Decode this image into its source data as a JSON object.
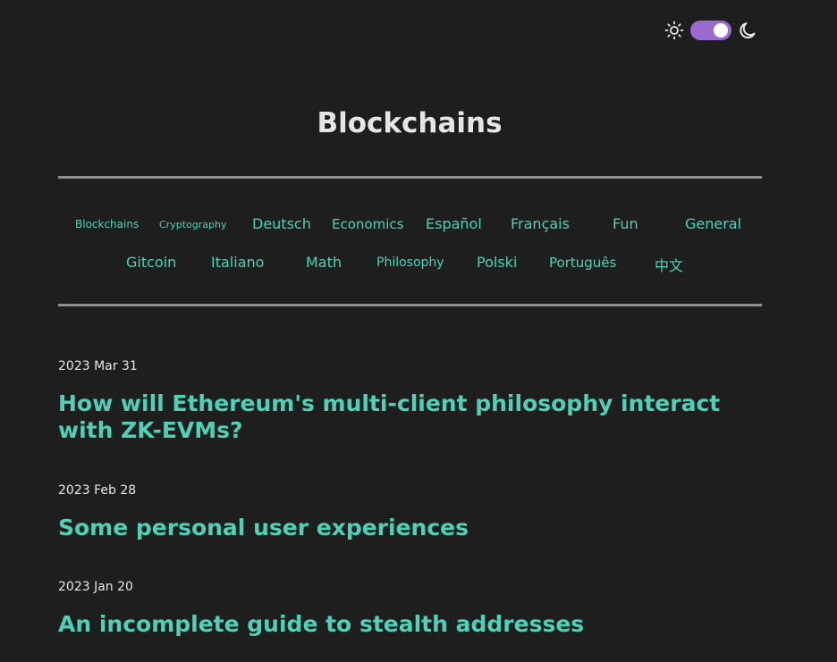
{
  "theme": {
    "switch_color": "#9b6ad1",
    "icons": [
      "sun-icon",
      "moon-icon"
    ],
    "dark_mode_enabled": true
  },
  "page": {
    "title": "Blockchains"
  },
  "categories": [
    "Blockchains",
    "Cryptography",
    "Deutsch",
    "Economics",
    "Español",
    "Français",
    "Fun",
    "General",
    "Gitcoin",
    "Italiano",
    "Math",
    "Philosophy",
    "Polski",
    "Português",
    "中文"
  ],
  "posts": [
    {
      "date": "2023 Mar 31",
      "title": "How will Ethereum's multi-client philosophy interact with ZK-EVMs?"
    },
    {
      "date": "2023 Feb 28",
      "title": "Some personal user experiences"
    },
    {
      "date": "2023 Jan 20",
      "title": "An incomplete guide to stealth addresses"
    }
  ],
  "colors": {
    "background": "#1e1e1e",
    "link": "#4fd1b8",
    "text": "#e6e6e6",
    "rule": "#8f8f8f"
  }
}
